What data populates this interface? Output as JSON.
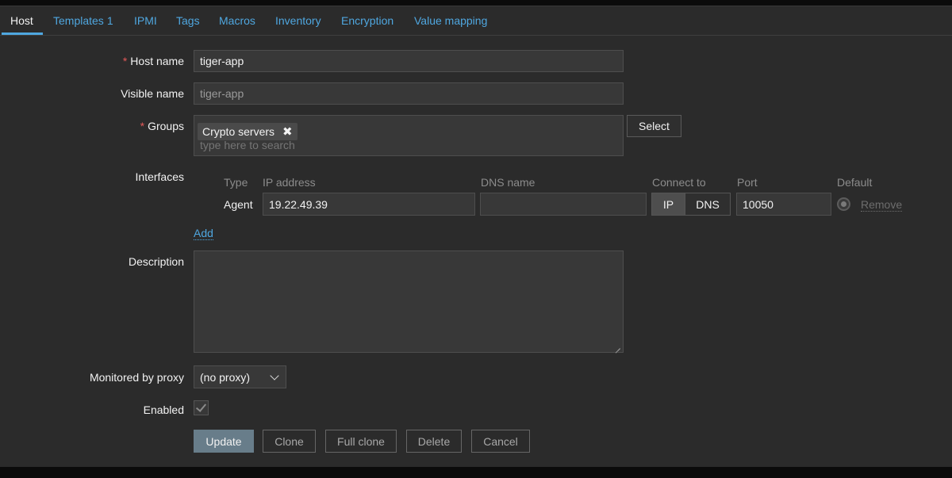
{
  "tabs": [
    {
      "label": "Host",
      "count": ""
    },
    {
      "label": "Templates",
      "count": "1"
    },
    {
      "label": "IPMI",
      "count": ""
    },
    {
      "label": "Tags",
      "count": ""
    },
    {
      "label": "Macros",
      "count": ""
    },
    {
      "label": "Inventory",
      "count": ""
    },
    {
      "label": "Encryption",
      "count": ""
    },
    {
      "label": "Value mapping",
      "count": ""
    }
  ],
  "form": {
    "required_mark": "*",
    "host_name": {
      "label": "Host name",
      "value": "tiger-app"
    },
    "visible_name": {
      "label": "Visible name",
      "value": "tiger-app"
    },
    "groups": {
      "label": "Groups",
      "chip": "Crypto servers",
      "chip_remove": "✖",
      "placeholder": "type here to search",
      "select_label": "Select"
    },
    "interfaces": {
      "label": "Interfaces",
      "columns": {
        "type": "Type",
        "ip": "IP address",
        "dns": "DNS name",
        "connect_to": "Connect to",
        "port": "Port",
        "default": "Default"
      },
      "row": {
        "type": "Agent",
        "ip": "19.22.49.39",
        "dns": "",
        "connect_ip": "IP",
        "connect_dns": "DNS",
        "port": "10050",
        "remove": "Remove"
      },
      "add": "Add"
    },
    "description": {
      "label": "Description",
      "value": ""
    },
    "proxy": {
      "label": "Monitored by proxy",
      "value": "(no proxy)"
    },
    "enabled": {
      "label": "Enabled",
      "checked": true
    }
  },
  "buttons": {
    "update": "Update",
    "clone": "Clone",
    "full_clone": "Full clone",
    "delete": "Delete",
    "cancel": "Cancel"
  },
  "colors": {
    "link": "#4fa7e0",
    "required": "#e45959",
    "primary_button": "#687d8a",
    "background": "#2b2b2b"
  }
}
